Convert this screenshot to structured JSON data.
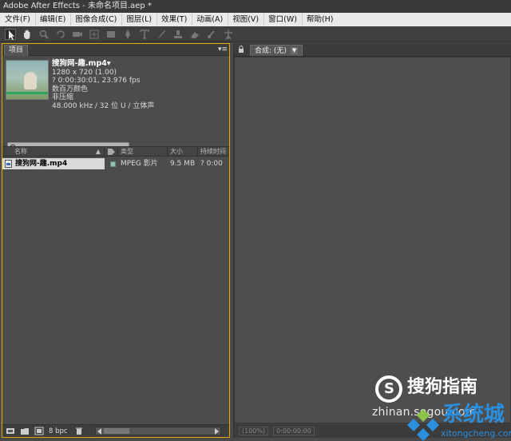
{
  "window": {
    "title": "Adobe After Effects - 未命名项目.aep *"
  },
  "menu": {
    "items": [
      {
        "label": "文件(F)"
      },
      {
        "label": "编辑(E)"
      },
      {
        "label": "图像合成(C)"
      },
      {
        "label": "图层(L)"
      },
      {
        "label": "效果(T)"
      },
      {
        "label": "动画(A)"
      },
      {
        "label": "视图(V)"
      },
      {
        "label": "窗口(W)"
      },
      {
        "label": "帮助(H)"
      }
    ]
  },
  "toolbar": {
    "tools": [
      "selection-tool-icon",
      "hand-tool-icon",
      "zoom-tool-icon",
      "rotate-tool-icon",
      "camera-tool-icon",
      "pan-behind-tool-icon",
      "shape-tool-icon",
      "pen-tool-icon",
      "text-tool-icon",
      "brush-tool-icon",
      "clone-stamp-tool-icon",
      "eraser-tool-icon",
      "roto-brush-tool-icon",
      "puppet-tool-icon"
    ]
  },
  "project_panel": {
    "tab_label": "项目",
    "footage": {
      "name": "搜狗网-趣.mp4▾",
      "resolution": "1280 x 720 (1.00)",
      "duration": "? 0:00:30:01, 23.976 fps",
      "colors": "数百万颜色",
      "compression": "非压缩",
      "audio": "48.000 kHz / 32 位 U / 立体声"
    },
    "search": {
      "placeholder": ""
    },
    "columns": {
      "name": "名称",
      "type": "类型",
      "size": "大小",
      "duration": "持续时间"
    },
    "rows": [
      {
        "name": "搜狗网-趣.mp4",
        "type": "MPEG 影片",
        "size": "9.5 MB",
        "duration": "? 0:00"
      }
    ],
    "footer": {
      "bpc": "8 bpc"
    }
  },
  "comp_panel": {
    "tab_label": "合成: (无)",
    "footer": {
      "zoom": "(100%)",
      "timecode": "0:00:00:00"
    }
  },
  "watermark": {
    "brand": "搜狗指南",
    "url": "zhinan.sogou.com",
    "site_name": "系统城",
    "site_url": "xitongcheng.com",
    "brand_color": "#2b8fe0"
  },
  "colors": {
    "panel_focus_border": "#e2a800",
    "selected_row_bg": "#d9d9d9"
  }
}
